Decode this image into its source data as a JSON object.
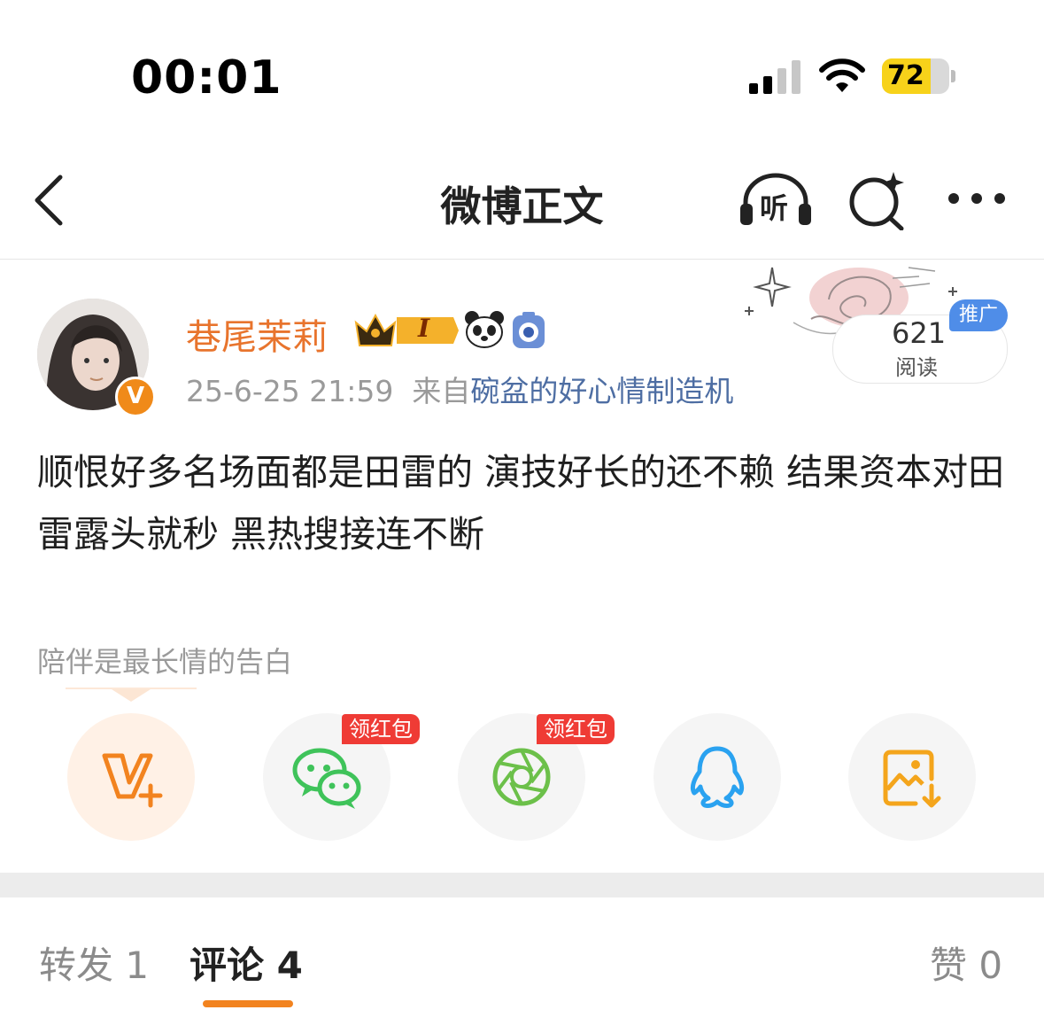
{
  "status_bar": {
    "time": "00:01",
    "battery": "72",
    "battery_level": 0.72
  },
  "nav": {
    "title": "微博正文",
    "listen_label": "听"
  },
  "post": {
    "username": "巷尾茉莉",
    "level_badge": "I",
    "timestamp": "25-6-25 21:59",
    "source_prefix": "来自",
    "source": "碗盆的好心情制造机",
    "read_count": "621",
    "read_label": "阅读",
    "promo_badge": "推广",
    "verified_mark": "V",
    "body": "顺恨好多名场面都是田雷的 演技好长的还不赖 结果资本对田雷露头就秒 黑热搜接连不断",
    "tag": "陪伴是最长情的告白"
  },
  "share": {
    "redpack_label": "领红包",
    "icons": [
      "vplus-icon",
      "wechat-icon",
      "moments-icon",
      "qq-icon",
      "save-image-icon"
    ]
  },
  "tabs": [
    {
      "label": "转发",
      "count": "1"
    },
    {
      "label": "评论",
      "count": "4"
    },
    {
      "label": "赞",
      "count": "0"
    }
  ],
  "colors": {
    "accent": "#f2831f",
    "username": "#e8742d",
    "source_link": "#4e6ea3",
    "redpack": "#ef3b35",
    "promo": "#4f8de8"
  }
}
